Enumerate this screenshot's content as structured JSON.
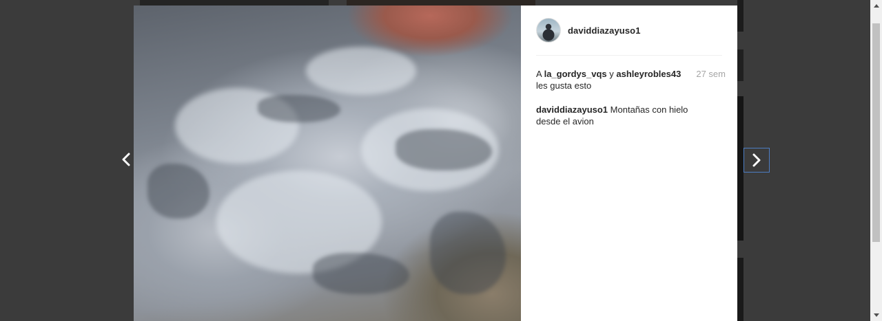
{
  "post": {
    "username": "daviddiazayuso1",
    "likes": {
      "prefix": "A",
      "user1": "la_gordys_vqs",
      "conjunction": "y",
      "user2": "ashleyrobles43",
      "suffix": "les gusta esto",
      "time": "27 sem"
    },
    "caption": {
      "author": "daviddiazayuso1",
      "text": "Montañas con hielo desde el avion"
    },
    "photo_description_icon": "mountain-photo"
  },
  "navigation": {
    "prev_icon": "chevron-left-icon",
    "next_icon": "chevron-right-icon"
  },
  "colors": {
    "panel_bg": "#ffffff",
    "text": "#262626",
    "muted": "#a5a5a5",
    "backdrop": "#3b3b3b",
    "focus_outline": "#4d7ec4"
  }
}
